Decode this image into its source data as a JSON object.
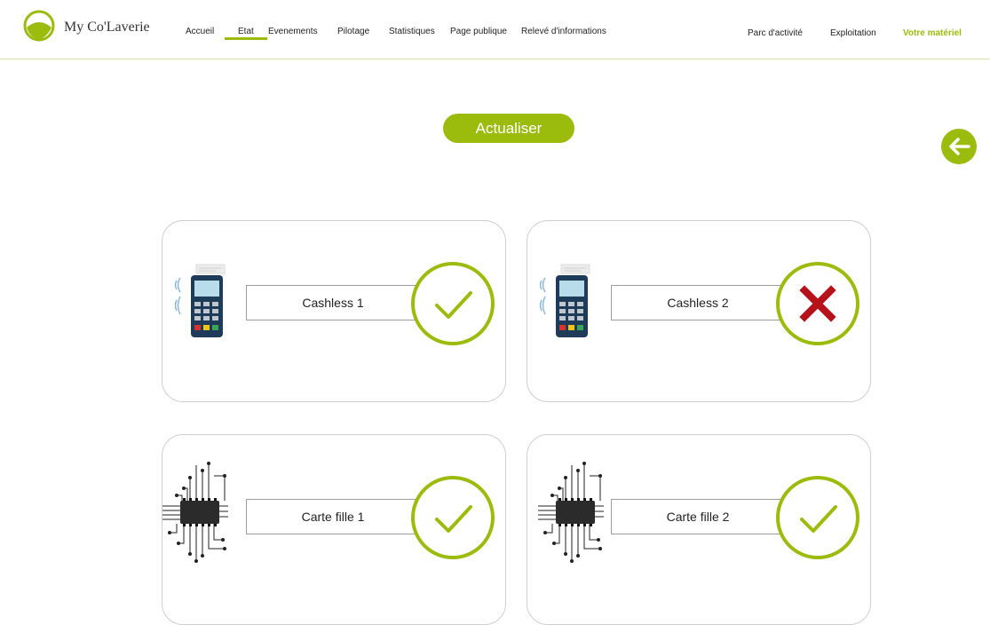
{
  "header": {
    "brand": "My Co'Laverie",
    "nav": [
      {
        "label": "Accueil",
        "active": false
      },
      {
        "label": "Etat",
        "active": true
      },
      {
        "label": "Evenements",
        "active": false
      },
      {
        "label": "Pilotage",
        "active": false
      },
      {
        "label": "Statistiques",
        "active": false
      },
      {
        "label": "Page publique",
        "active": false
      },
      {
        "label": "Relevé d'informations",
        "active": false
      }
    ],
    "right_nav": [
      {
        "label": "Parc d'activité",
        "active": false
      },
      {
        "label": "Exploitation",
        "active": false
      },
      {
        "label": "Votre matériel",
        "active": true
      }
    ]
  },
  "actions": {
    "refresh_label": "Actualiser",
    "back_icon": "arrow-left-icon"
  },
  "cards": [
    {
      "name": "Cashless 1",
      "device": "payment-terminal-icon",
      "status": "ok"
    },
    {
      "name": "Cashless 2",
      "device": "payment-terminal-icon",
      "status": "error"
    },
    {
      "name": "Carte fille 1",
      "device": "chip-icon",
      "status": "ok"
    },
    {
      "name": "Carte fille 2",
      "device": "chip-icon",
      "status": "ok"
    }
  ],
  "colors": {
    "accent": "#9bbb0d",
    "error": "#b5121b",
    "card_border": "#cfcfcf"
  }
}
